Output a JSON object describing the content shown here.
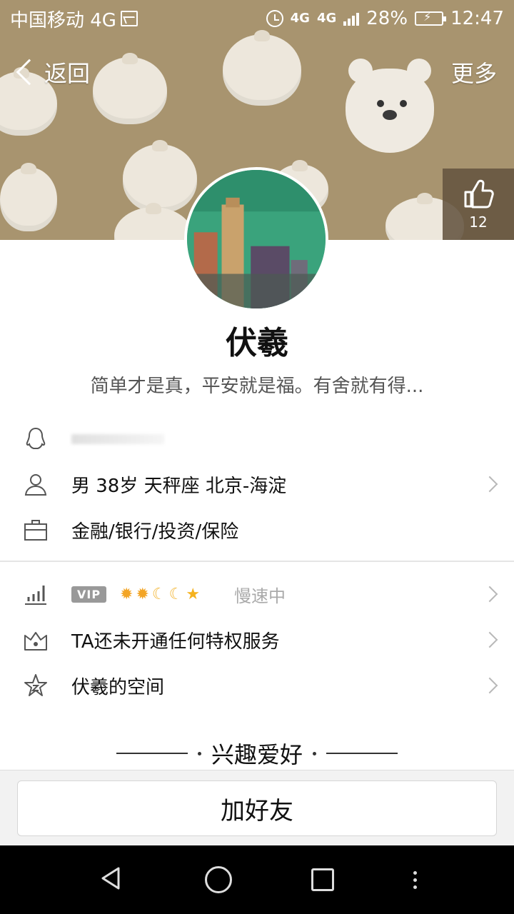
{
  "status_bar": {
    "carrier": "中国移动 4G",
    "network_1": "4G",
    "network_2": "4G",
    "battery": "28%",
    "time": "12:47"
  },
  "nav": {
    "back_label": "返回",
    "more_label": "更多"
  },
  "like": {
    "count": "12"
  },
  "profile": {
    "name": "伏羲",
    "signature": "简单才是真，平安就是福。有舍就有得..."
  },
  "info": {
    "basic": "男  38岁  天秤座  北京-海淀",
    "occupation": "金融/银行/投资/保险"
  },
  "vip": {
    "badge": "VIP",
    "level_icons": [
      "sun",
      "sun",
      "moon",
      "moon",
      "star"
    ],
    "status": "慢速中"
  },
  "privilege": {
    "label": "TA还未开通任何特权服务"
  },
  "space": {
    "label": "伏羲的空间"
  },
  "interests": {
    "title": "兴趣爱好"
  },
  "actions": {
    "add_friend": "加好友"
  },
  "colors": {
    "cover_bg": "#a8946f",
    "like_bg": "#645440",
    "vip_badge": "#999999"
  }
}
